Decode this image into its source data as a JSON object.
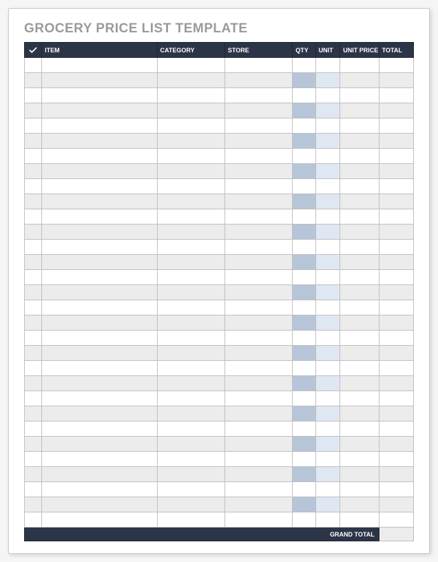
{
  "title": "GROCERY PRICE LIST TEMPLATE",
  "columns": {
    "check": "",
    "item": "ITEM",
    "category": "CATEGORY",
    "store": "STORE",
    "qty": "QTY",
    "unit": "UNIT",
    "unit_price": "UNIT PRICE",
    "total": "TOTAL"
  },
  "rows": [
    {
      "check": "",
      "item": "",
      "category": "",
      "store": "",
      "qty": "",
      "unit": "",
      "unit_price": "",
      "total": ""
    },
    {
      "check": "",
      "item": "",
      "category": "",
      "store": "",
      "qty": "",
      "unit": "",
      "unit_price": "",
      "total": ""
    },
    {
      "check": "",
      "item": "",
      "category": "",
      "store": "",
      "qty": "",
      "unit": "",
      "unit_price": "",
      "total": ""
    },
    {
      "check": "",
      "item": "",
      "category": "",
      "store": "",
      "qty": "",
      "unit": "",
      "unit_price": "",
      "total": ""
    },
    {
      "check": "",
      "item": "",
      "category": "",
      "store": "",
      "qty": "",
      "unit": "",
      "unit_price": "",
      "total": ""
    },
    {
      "check": "",
      "item": "",
      "category": "",
      "store": "",
      "qty": "",
      "unit": "",
      "unit_price": "",
      "total": ""
    },
    {
      "check": "",
      "item": "",
      "category": "",
      "store": "",
      "qty": "",
      "unit": "",
      "unit_price": "",
      "total": ""
    },
    {
      "check": "",
      "item": "",
      "category": "",
      "store": "",
      "qty": "",
      "unit": "",
      "unit_price": "",
      "total": ""
    },
    {
      "check": "",
      "item": "",
      "category": "",
      "store": "",
      "qty": "",
      "unit": "",
      "unit_price": "",
      "total": ""
    },
    {
      "check": "",
      "item": "",
      "category": "",
      "store": "",
      "qty": "",
      "unit": "",
      "unit_price": "",
      "total": ""
    },
    {
      "check": "",
      "item": "",
      "category": "",
      "store": "",
      "qty": "",
      "unit": "",
      "unit_price": "",
      "total": ""
    },
    {
      "check": "",
      "item": "",
      "category": "",
      "store": "",
      "qty": "",
      "unit": "",
      "unit_price": "",
      "total": ""
    },
    {
      "check": "",
      "item": "",
      "category": "",
      "store": "",
      "qty": "",
      "unit": "",
      "unit_price": "",
      "total": ""
    },
    {
      "check": "",
      "item": "",
      "category": "",
      "store": "",
      "qty": "",
      "unit": "",
      "unit_price": "",
      "total": ""
    },
    {
      "check": "",
      "item": "",
      "category": "",
      "store": "",
      "qty": "",
      "unit": "",
      "unit_price": "",
      "total": ""
    },
    {
      "check": "",
      "item": "",
      "category": "",
      "store": "",
      "qty": "",
      "unit": "",
      "unit_price": "",
      "total": ""
    },
    {
      "check": "",
      "item": "",
      "category": "",
      "store": "",
      "qty": "",
      "unit": "",
      "unit_price": "",
      "total": ""
    },
    {
      "check": "",
      "item": "",
      "category": "",
      "store": "",
      "qty": "",
      "unit": "",
      "unit_price": "",
      "total": ""
    },
    {
      "check": "",
      "item": "",
      "category": "",
      "store": "",
      "qty": "",
      "unit": "",
      "unit_price": "",
      "total": ""
    },
    {
      "check": "",
      "item": "",
      "category": "",
      "store": "",
      "qty": "",
      "unit": "",
      "unit_price": "",
      "total": ""
    },
    {
      "check": "",
      "item": "",
      "category": "",
      "store": "",
      "qty": "",
      "unit": "",
      "unit_price": "",
      "total": ""
    },
    {
      "check": "",
      "item": "",
      "category": "",
      "store": "",
      "qty": "",
      "unit": "",
      "unit_price": "",
      "total": ""
    },
    {
      "check": "",
      "item": "",
      "category": "",
      "store": "",
      "qty": "",
      "unit": "",
      "unit_price": "",
      "total": ""
    },
    {
      "check": "",
      "item": "",
      "category": "",
      "store": "",
      "qty": "",
      "unit": "",
      "unit_price": "",
      "total": ""
    },
    {
      "check": "",
      "item": "",
      "category": "",
      "store": "",
      "qty": "",
      "unit": "",
      "unit_price": "",
      "total": ""
    },
    {
      "check": "",
      "item": "",
      "category": "",
      "store": "",
      "qty": "",
      "unit": "",
      "unit_price": "",
      "total": ""
    },
    {
      "check": "",
      "item": "",
      "category": "",
      "store": "",
      "qty": "",
      "unit": "",
      "unit_price": "",
      "total": ""
    },
    {
      "check": "",
      "item": "",
      "category": "",
      "store": "",
      "qty": "",
      "unit": "",
      "unit_price": "",
      "total": ""
    },
    {
      "check": "",
      "item": "",
      "category": "",
      "store": "",
      "qty": "",
      "unit": "",
      "unit_price": "",
      "total": ""
    },
    {
      "check": "",
      "item": "",
      "category": "",
      "store": "",
      "qty": "",
      "unit": "",
      "unit_price": "",
      "total": ""
    },
    {
      "check": "",
      "item": "",
      "category": "",
      "store": "",
      "qty": "",
      "unit": "",
      "unit_price": "",
      "total": ""
    }
  ],
  "footer": {
    "grand_total_label": "GRAND TOTAL",
    "grand_total_value": ""
  }
}
